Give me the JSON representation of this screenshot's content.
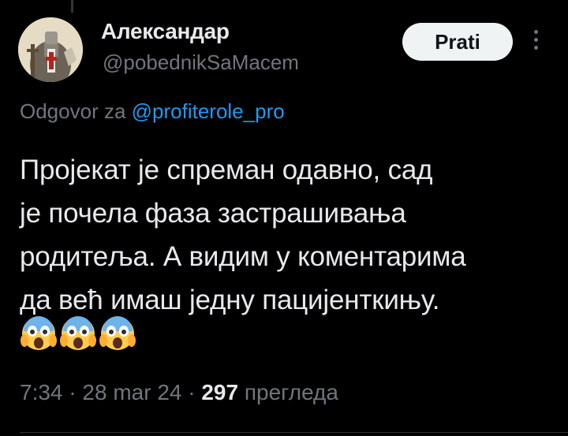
{
  "author": {
    "name": "Александар",
    "handle": "@pobednikSaMacem"
  },
  "follow_label": "Prati",
  "reply": {
    "prefix": "Odgovor za",
    "mention": "@profiterole_pro"
  },
  "tweet": {
    "lines": [
      "Пројекат је спреман одавно, сад",
      "је почела фаза застрашивања",
      "родитеља. А видим у коментарима",
      "да већ имаш једну пацијенткињу."
    ],
    "emojis": [
      "screaming-face-icon",
      "screaming-face-icon",
      "screaming-face-icon"
    ]
  },
  "meta": {
    "time": "7:34",
    "date": "28 mar 24",
    "views_count": "297",
    "views_label": "прегледа",
    "separator": "·"
  },
  "colors": {
    "background": "#000000",
    "text": "#e7e9ea",
    "muted": "#71767b",
    "link": "#1d9bf0",
    "button_bg": "#eff3f4"
  }
}
